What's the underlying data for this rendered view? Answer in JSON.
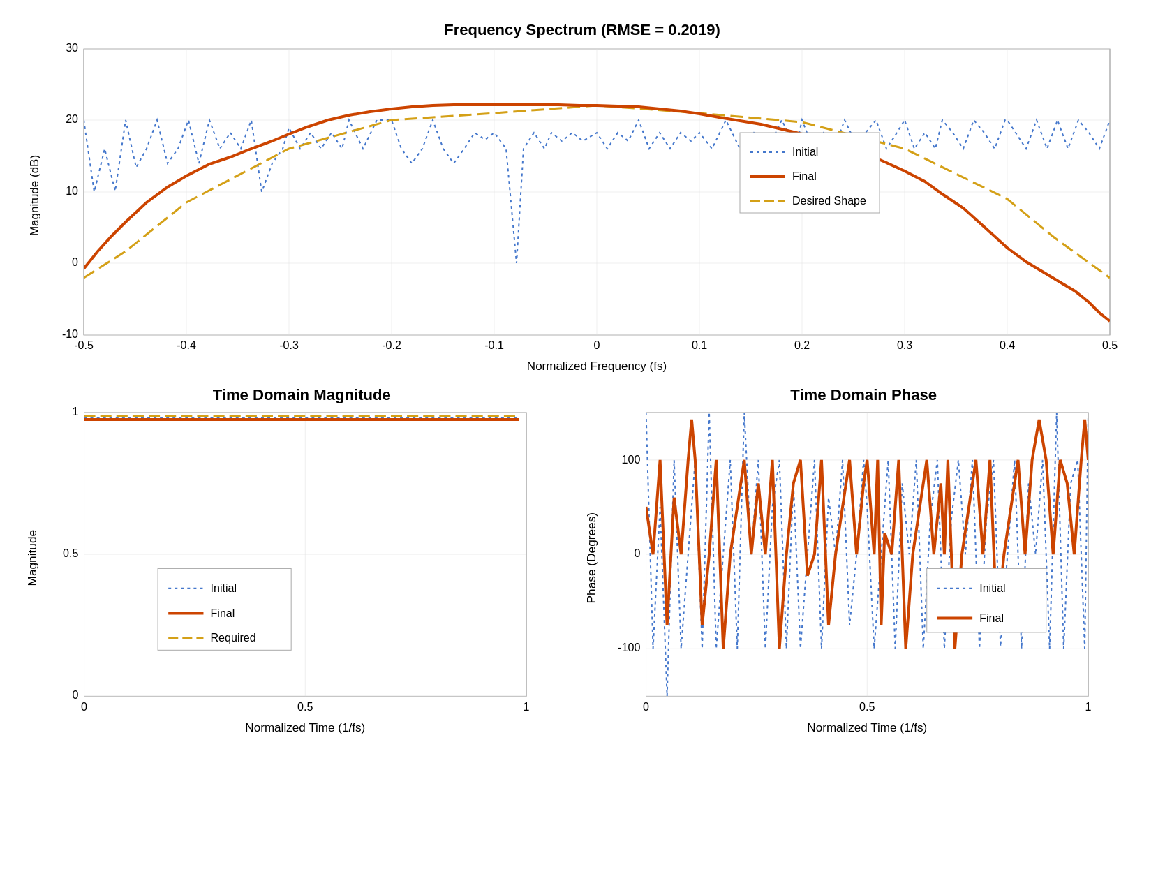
{
  "top_chart": {
    "title": "Frequency Spectrum (RMSE = 0.2019)",
    "x_label": "Normalized Frequency (fs)",
    "y_label": "Magnitude (dB)",
    "y_min": -10,
    "y_max": 30,
    "x_min": -0.5,
    "x_max": 0.5,
    "x_ticks": [
      "-0.5",
      "-0.4",
      "-0.3",
      "-0.2",
      "-0.1",
      "0",
      "0.1",
      "0.2",
      "0.3",
      "0.4",
      "0.5"
    ],
    "y_ticks": [
      "-10",
      "0",
      "10",
      "20",
      "30"
    ],
    "legend": {
      "items": [
        {
          "label": "Initial",
          "style": "dotted-blue"
        },
        {
          "label": "Final",
          "style": "solid-orange"
        },
        {
          "label": "Desired Shape",
          "style": "dashed-yellow"
        }
      ]
    }
  },
  "bottom_left_chart": {
    "title": "Time Domain Magnitude",
    "x_label": "Normalized Time (1/fs)",
    "y_label": "Magnitude",
    "y_min": 0,
    "y_max": 1,
    "x_min": 0,
    "x_max": 1,
    "x_ticks": [
      "0",
      "0.5",
      "1"
    ],
    "y_ticks": [
      "0",
      "0.5",
      "1"
    ],
    "legend": {
      "items": [
        {
          "label": "Initial",
          "style": "dotted-blue"
        },
        {
          "label": "Final",
          "style": "solid-orange"
        },
        {
          "label": "Required",
          "style": "dashed-yellow"
        }
      ]
    }
  },
  "bottom_right_chart": {
    "title": "Time Domain Phase",
    "x_label": "Normalized Time (1/fs)",
    "y_label": "Phase (Degrees)",
    "y_min": -150,
    "y_max": 150,
    "x_min": 0,
    "x_max": 1,
    "x_ticks": [
      "0",
      "0.5",
      "1"
    ],
    "y_ticks": [
      "-100",
      "0",
      "100"
    ],
    "legend": {
      "items": [
        {
          "label": "Initial",
          "style": "dotted-blue"
        },
        {
          "label": "Final",
          "style": "solid-orange"
        }
      ]
    }
  }
}
